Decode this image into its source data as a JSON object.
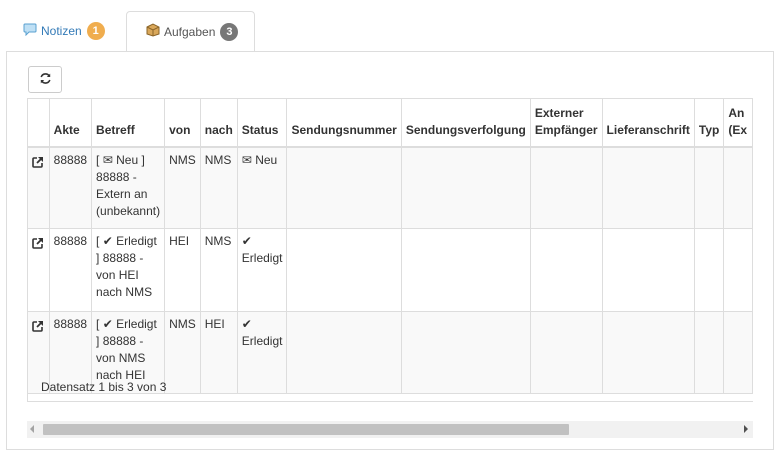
{
  "tabs": [
    {
      "label": "Notizen",
      "badge": "1",
      "icon": "comment-icon"
    },
    {
      "label": "Aufgaben",
      "badge": "3",
      "icon": "package-icon"
    }
  ],
  "toolbar": {
    "refresh_icon": "refresh-icon"
  },
  "table": {
    "columns": [
      "Akte",
      "Betreff",
      "von",
      "nach",
      "Status",
      "Sendungsnummer",
      "Sendungsverfolgung",
      "Externer Empfänger",
      "Lieferanschrift",
      "Typ",
      "An (Ex"
    ],
    "rows": [
      {
        "akte": "88888",
        "betreff_status": "Neu",
        "betreff_text": "88888 - Extern an (unbekannt)",
        "von": "NMS",
        "nach": "NMS",
        "status": "Neu",
        "status_icon": "envelope-icon"
      },
      {
        "akte": "88888",
        "betreff_status": "Erledigt",
        "betreff_text": "88888 - von HEI nach NMS",
        "von": "HEI",
        "nach": "NMS",
        "status": "Erledigt",
        "status_icon": "check-icon"
      },
      {
        "akte": "88888",
        "betreff_status": "Erledigt",
        "betreff_text": "88888 - von NMS nach HEI",
        "von": "NMS",
        "nach": "HEI",
        "status": "Erledigt",
        "status_icon": "check-icon"
      }
    ]
  },
  "footer": {
    "info": "Datensatz 1 bis 3 von 3"
  },
  "colors": {
    "link": "#337ab7",
    "badge_warn": "#f0ad4e",
    "badge_dark": "#777777",
    "border": "#dddddd"
  }
}
